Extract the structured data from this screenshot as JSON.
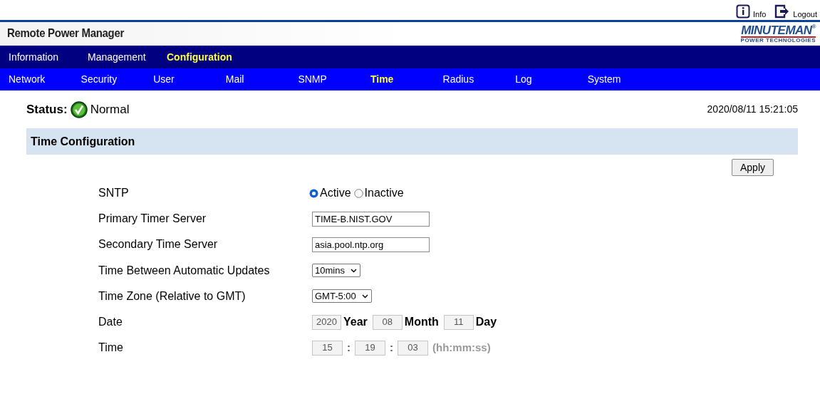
{
  "top_links": [
    {
      "kind": "info",
      "label": "Info"
    },
    {
      "kind": "logout",
      "label": "Logout"
    }
  ],
  "header": {
    "title": "Remote Power Manager",
    "logo": {
      "name": "MINUTE",
      "name2": "MAN",
      "mark": "®",
      "tagline": "POWER TECHNOLOGIES"
    }
  },
  "main_nav": [
    {
      "label": "Information",
      "selected": false
    },
    {
      "label": "Management",
      "selected": false
    },
    {
      "label": "Configuration",
      "selected": true
    }
  ],
  "sub_nav": [
    {
      "label": "Network",
      "selected": false
    },
    {
      "label": "Security",
      "selected": false
    },
    {
      "label": "User",
      "selected": false
    },
    {
      "label": "Mail",
      "selected": false
    },
    {
      "label": "SNMP",
      "selected": false
    },
    {
      "label": "Time",
      "selected": true
    },
    {
      "label": "Radius",
      "selected": false
    },
    {
      "label": "Log",
      "selected": false
    },
    {
      "label": "System",
      "selected": false
    }
  ],
  "status": {
    "label": "Status:",
    "value": "Normal",
    "datetime": "2020/08/11 15:21:05"
  },
  "section": {
    "title": "Time Configuration",
    "apply": "Apply"
  },
  "rows": [
    {
      "kind": "radio",
      "label": "SNTP",
      "options": [
        {
          "label": "Active",
          "selected": true
        },
        {
          "label": "Inactive",
          "selected": false
        }
      ]
    },
    {
      "kind": "text",
      "label": "Primary Timer Server",
      "value": "TIME-B.NIST.GOV"
    },
    {
      "kind": "text",
      "label": "Secondary Time Server",
      "value": "asia.pool.ntp.org"
    },
    {
      "kind": "select",
      "label": "Time Between Automatic Updates",
      "value": "10mins"
    },
    {
      "kind": "select",
      "label": "Time Zone (Relative to GMT)",
      "value": "GMT-5:00"
    },
    {
      "kind": "date",
      "label": "Date",
      "parts": [
        {
          "value": "2020",
          "unit": "Year"
        },
        {
          "value": "08",
          "unit": "Month"
        },
        {
          "value": "11",
          "unit": "Day"
        }
      ]
    },
    {
      "kind": "time",
      "label": "Time",
      "parts": [
        "15",
        "19",
        "03"
      ],
      "separator": ":",
      "hint": "(hh:mm:ss)"
    }
  ]
}
